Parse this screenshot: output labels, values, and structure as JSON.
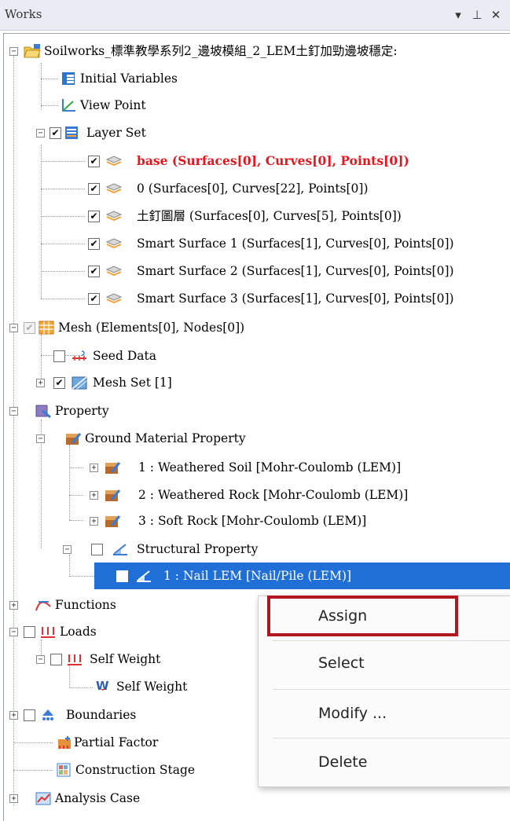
{
  "panel": {
    "title": "Works",
    "buttons": {
      "dropdown": "▾",
      "pin": "⊥",
      "close": "✕"
    }
  },
  "tree": {
    "root": "Soilworks_標準教學系列2_邊坡模組_2_LEM土釘加勁邊坡穩定:",
    "initial_variables": "Initial Variables",
    "view_point": "View Point",
    "layer_set": "Layer Set",
    "layers": [
      "base (Surfaces[0], Curves[0], Points[0])",
      "0 (Surfaces[0], Curves[22], Points[0])",
      "土釘圖層 (Surfaces[0], Curves[5], Points[0])",
      "Smart Surface 1 (Surfaces[1], Curves[0], Points[0])",
      "Smart Surface 2 (Surfaces[1], Curves[0], Points[0])",
      "Smart Surface 3 (Surfaces[1], Curves[0], Points[0])"
    ],
    "mesh": "Mesh (Elements[0], Nodes[0])",
    "seed_data": "Seed Data",
    "mesh_set": "Mesh Set [1]",
    "property": "Property",
    "ground_material_property": "Ground Material Property",
    "materials": [
      "1 : Weathered Soil [Mohr-Coulomb (LEM)]",
      "2 : Weathered Rock [Mohr-Coulomb (LEM)]",
      "3 : Soft Rock [Mohr-Coulomb (LEM)]"
    ],
    "structural_property": "Structural Property",
    "nail": "1 : Nail LEM [Nail/Pile (LEM)]",
    "functions": "Functions",
    "loads": "Loads",
    "self_weight_group": "Self Weight",
    "self_weight": "Self Weight",
    "boundaries": "Boundaries",
    "partial_factor": "Partial Factor",
    "construction_stage": "Construction Stage",
    "analysis_case": "Analysis Case"
  },
  "context_menu": {
    "assign": "Assign",
    "select": "Select",
    "modify": "Modify ...",
    "delete": "Delete"
  },
  "colors": {
    "selection": "#1f6fd6",
    "active_layer_text": "#e8141c",
    "assign_highlight": "#b0171f"
  }
}
